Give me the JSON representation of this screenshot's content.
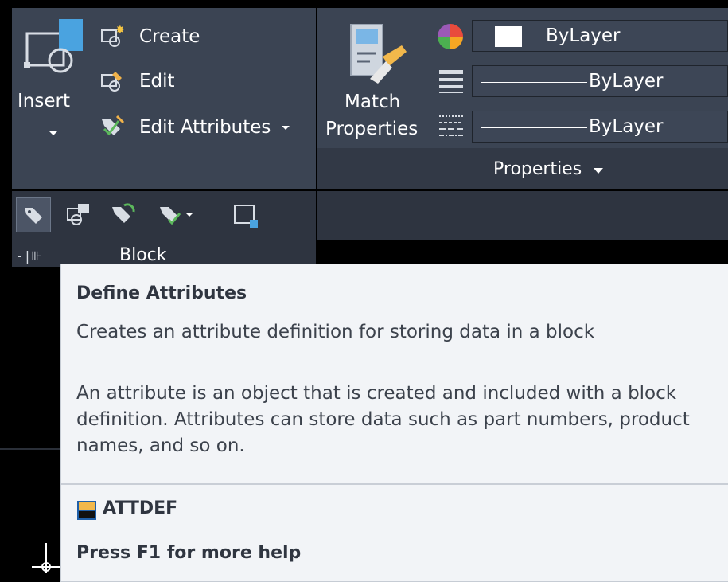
{
  "block_panel": {
    "insert_label": "Insert",
    "create_label": "Create",
    "edit_label": "Edit",
    "edit_attributes_label": "Edit Attributes",
    "panel_title": "Block"
  },
  "properties_panel": {
    "match_label_line1": "Match",
    "match_label_line2": "Properties",
    "color_value": "ByLayer",
    "lineweight_value": "ByLayer",
    "linetype_value": "ByLayer",
    "panel_title": "Properties"
  },
  "tooltip": {
    "title": "Define Attributes",
    "description": "Creates an attribute definition for storing data in a block",
    "details": "An attribute is an object that is created and included with a block definition. Attributes can store data such as part numbers, product names, and so on.",
    "command": "ATTDEF",
    "help": "Press F1 for more help"
  },
  "colors": {
    "ribbon_bg": "#3b4453",
    "tooltip_bg": "#f2f4f7",
    "canvas_bg": "#000000"
  }
}
